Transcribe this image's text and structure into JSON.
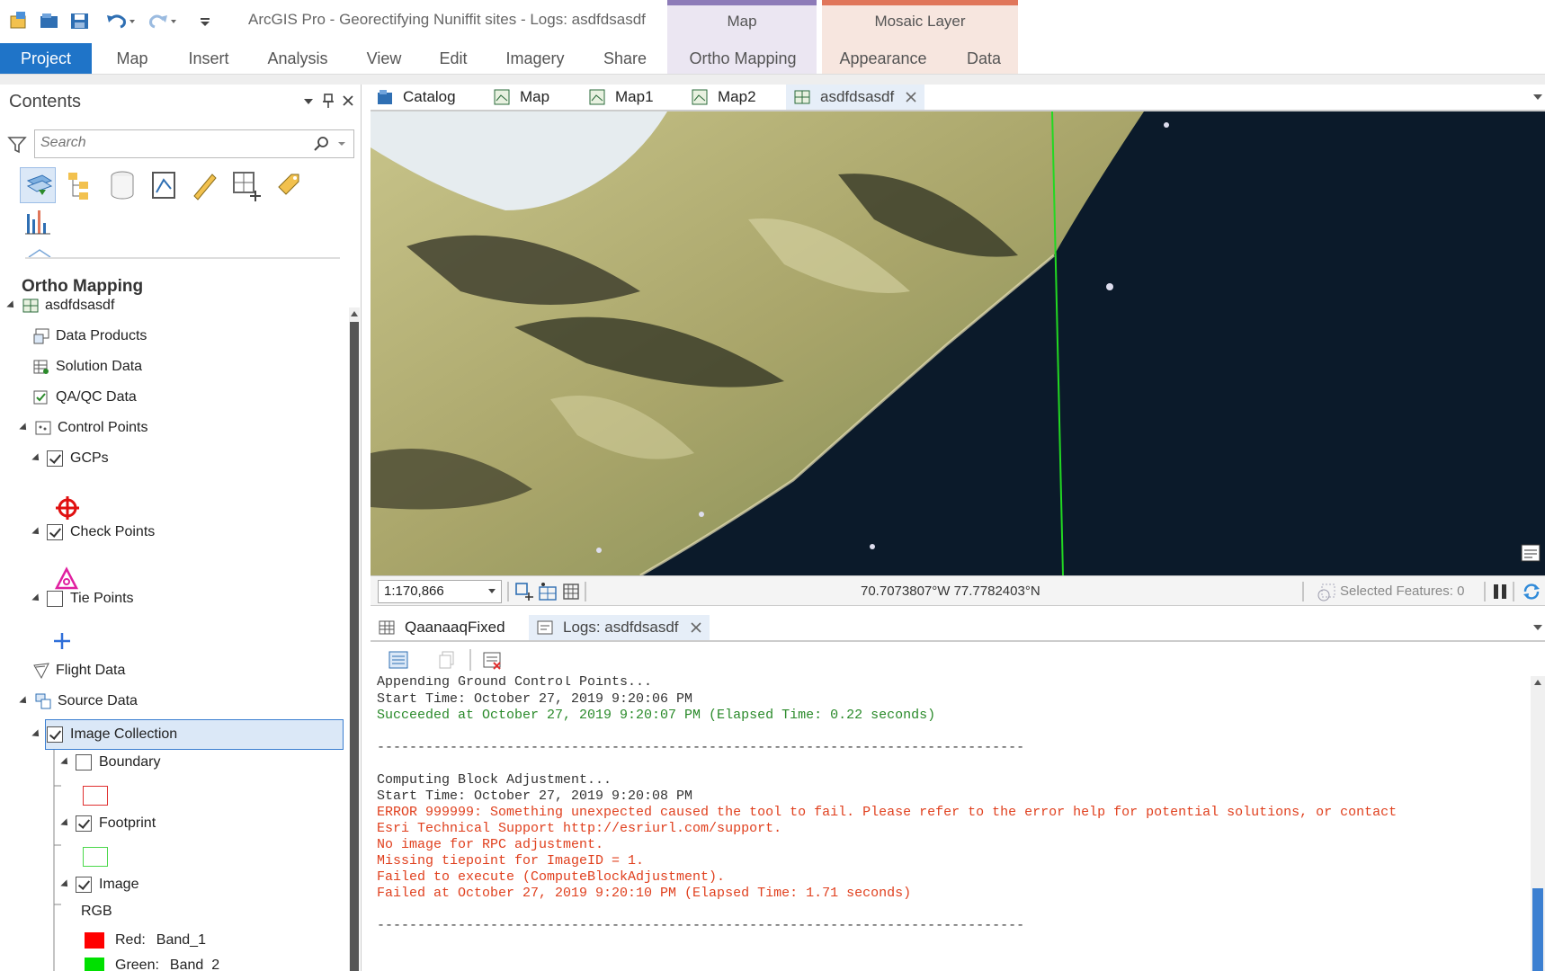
{
  "app": {
    "title": "ArcGIS Pro - Georectifying Nuniffit sites - Logs: asdfdsasdf"
  },
  "ribbon": {
    "contextual": [
      {
        "label": "Map",
        "tab": "Ortho Mapping"
      },
      {
        "label": "Mosaic Layer",
        "tabs": [
          "Appearance",
          "Data"
        ]
      }
    ],
    "tabs": [
      "Project",
      "Map",
      "Insert",
      "Analysis",
      "View",
      "Edit",
      "Imagery",
      "Share"
    ],
    "ortho_tab": "Ortho Mapping",
    "appearance_tab": "Appearance",
    "data_tab": "Data",
    "active_color": "#1f74c8"
  },
  "contents": {
    "title": "Contents",
    "search_placeholder": "Search",
    "section_title": "Ortho Mapping",
    "tree": {
      "root": "asdfdsasdf",
      "data_products": "Data Products",
      "solution_data": "Solution Data",
      "qaqc_data": "QA/QC Data",
      "control_points": "Control Points",
      "gcps": "GCPs",
      "check_points": "Check Points",
      "tie_points": "Tie Points",
      "flight_data": "Flight Data",
      "source_data": "Source Data",
      "image_collection": "Image Collection",
      "boundary": "Boundary",
      "footprint": "Footprint",
      "image": "Image",
      "rgb": "RGB",
      "red_label": "Red:",
      "red_band": "Band_1",
      "green_label": "Green:",
      "green_band": "Band_2"
    }
  },
  "view_tabs": [
    "Catalog",
    "Map",
    "Map1",
    "Map2",
    "asdfdsasdf"
  ],
  "map_status": {
    "scale": "1:170,866",
    "coordinates": "70.7073807°W 77.7782403°N",
    "selected_features": "Selected Features: 0"
  },
  "bottom_tabs": [
    "QaanaaqFixed",
    "Logs: asdfdsasdf"
  ],
  "log": {
    "lines": [
      {
        "text": "Appending Ground Control Points...",
        "color": "black"
      },
      {
        "text": "Start Time: October 27, 2019 9:20:06 PM",
        "color": "black"
      },
      {
        "text": "Succeeded at October 27, 2019 9:20:07 PM (Elapsed Time: 0.22 seconds)",
        "color": "green"
      },
      {
        "text": "",
        "color": "black"
      },
      {
        "text": "--------------------------------------------------------------------------------",
        "color": "black"
      },
      {
        "text": "",
        "color": "black"
      },
      {
        "text": "Computing Block Adjustment...",
        "color": "black"
      },
      {
        "text": "Start Time: October 27, 2019 9:20:08 PM",
        "color": "black"
      },
      {
        "text": "ERROR 999999: Something unexpected caused the tool to fail. Please refer to the error help for potential solutions, or contact",
        "color": "red"
      },
      {
        "text": "Esri Technical Support http://esriurl.com/support.",
        "color": "red"
      },
      {
        "text": "No image for RPC adjustment.",
        "color": "red"
      },
      {
        "text": "Missing tiepoint for ImageID = 1.",
        "color": "red"
      },
      {
        "text": "Failed to execute (ComputeBlockAdjustment).",
        "color": "red"
      },
      {
        "text": "Failed at October 27, 2019 9:20:10 PM (Elapsed Time: 1.71 seconds)",
        "color": "red"
      },
      {
        "text": "",
        "color": "black"
      },
      {
        "text": "--------------------------------------------------------------------------------",
        "color": "black"
      }
    ]
  }
}
